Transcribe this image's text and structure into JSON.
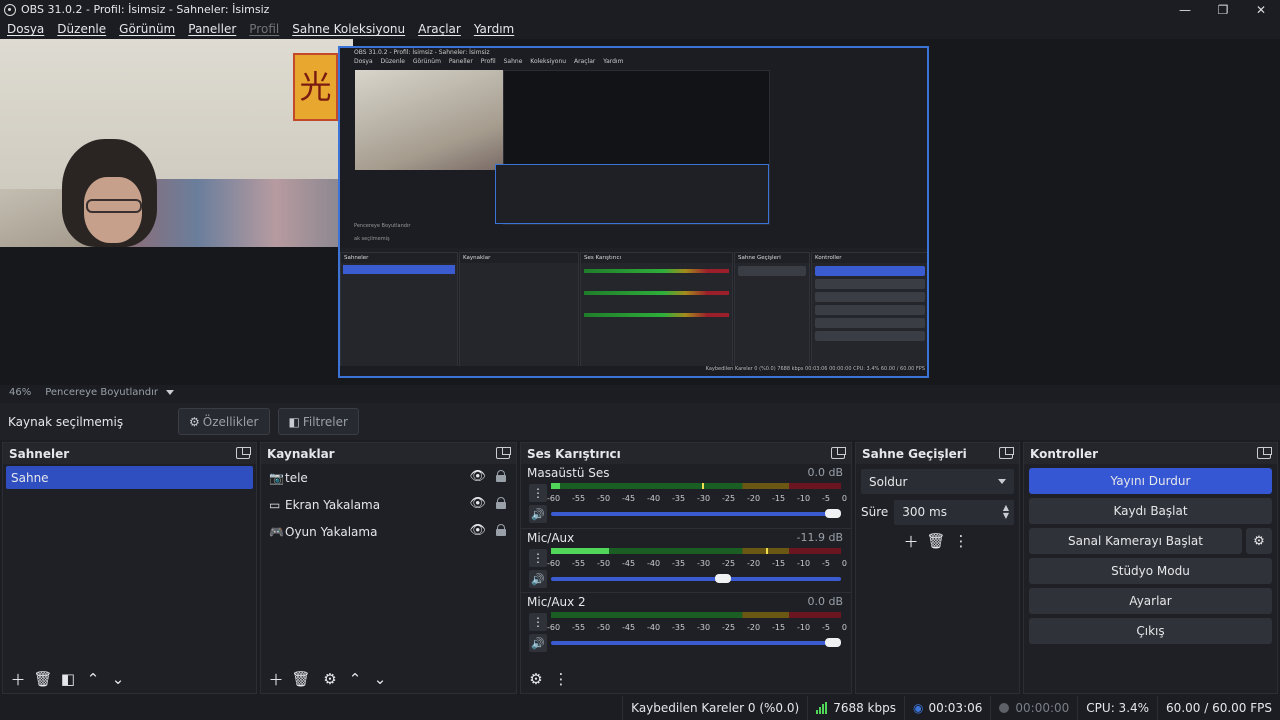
{
  "window": {
    "title": "OBS 31.0.2 - Profil: İsimsiz - Sahneler: İsimsiz",
    "controls": [
      "—",
      "❐",
      "✕"
    ]
  },
  "menu": [
    "Dosya",
    "Düzenle",
    "Görünüm",
    "Paneller",
    "Profil",
    "Sahne Koleksiyonu",
    "Araçlar",
    "Yardım"
  ],
  "nested_preview": {
    "title": "OBS 31.0.2 - Profil: İsimsiz - Sahneler: İsimsiz",
    "menu": "Dosya Düzenle Görünüm Paneller Profil Sahne Koleksiyonu Araçlar Yardım",
    "zoom": "Pencereye Boyutlandır",
    "context": "ak seçilmemiş",
    "scenes_title": "Sahneler",
    "sources_title": "Kaynaklar",
    "mixer_title": "Ses Karıştırıcı",
    "trans_title": "Sahne Geçişleri",
    "controls_title": "Kontroller",
    "status": "Kaybedilen Kareler 0 (%0.0)   7688 kbps   00:03:06   00:00:00   CPU: 3.4%   60.00 / 60.00 FPS"
  },
  "zoom": {
    "value": "46%",
    "mode": "Pencereye Boyutlandır"
  },
  "context": {
    "label": "Kaynak seçilmemiş",
    "properties": "Özellikler",
    "filters": "Filtreler"
  },
  "scenes": {
    "title": "Sahneler",
    "items": [
      "Sahne"
    ]
  },
  "sources": {
    "title": "Kaynaklar",
    "items": [
      {
        "label": "tele",
        "icon": "camera-icon"
      },
      {
        "label": "Ekran Yakalama",
        "icon": "monitor-icon"
      },
      {
        "label": "Oyun Yakalama",
        "icon": "gamepad-icon"
      }
    ]
  },
  "mixer": {
    "title": "Ses Karıştırıcı",
    "scale": [
      "-60",
      "-55",
      "-50",
      "-45",
      "-40",
      "-35",
      "-30",
      "-25",
      "-20",
      "-15",
      "-10",
      "-5",
      "0"
    ],
    "channels": [
      {
        "name": "Masaüstü Ses",
        "db": "0.0 dB",
        "level": 0.03,
        "peak": 0.52,
        "volume": 1.0
      },
      {
        "name": "Mic/Aux",
        "db": "-11.9 dB",
        "level": 0.2,
        "peak": 0.74,
        "volume": 0.6
      },
      {
        "name": "Mic/Aux 2",
        "db": "0.0 dB",
        "level": 0.0,
        "peak": null,
        "volume": 1.0
      }
    ]
  },
  "transitions": {
    "title": "Sahne Geçişleri",
    "selected": "Soldur",
    "duration_label": "Süre",
    "duration_value": "300 ms"
  },
  "controls": {
    "title": "Kontroller",
    "stop_stream": "Yayını Durdur",
    "start_record": "Kaydı Başlat",
    "virtual_cam": "Sanal Kamerayı Başlat",
    "studio_mode": "Stüdyo Modu",
    "settings": "Ayarlar",
    "exit": "Çıkış"
  },
  "status": {
    "dropped": "Kaybedilen Kareler 0 (%0.0)",
    "bitrate": "7688 kbps",
    "live_time": "00:03:06",
    "rec_time": "00:00:00",
    "cpu": "CPU: 3.4%",
    "fps": "60.00 / 60.00 FPS"
  },
  "colors": {
    "accent": "#3557d4",
    "meter_green": "#52d65a",
    "background": "#1b1d22"
  }
}
